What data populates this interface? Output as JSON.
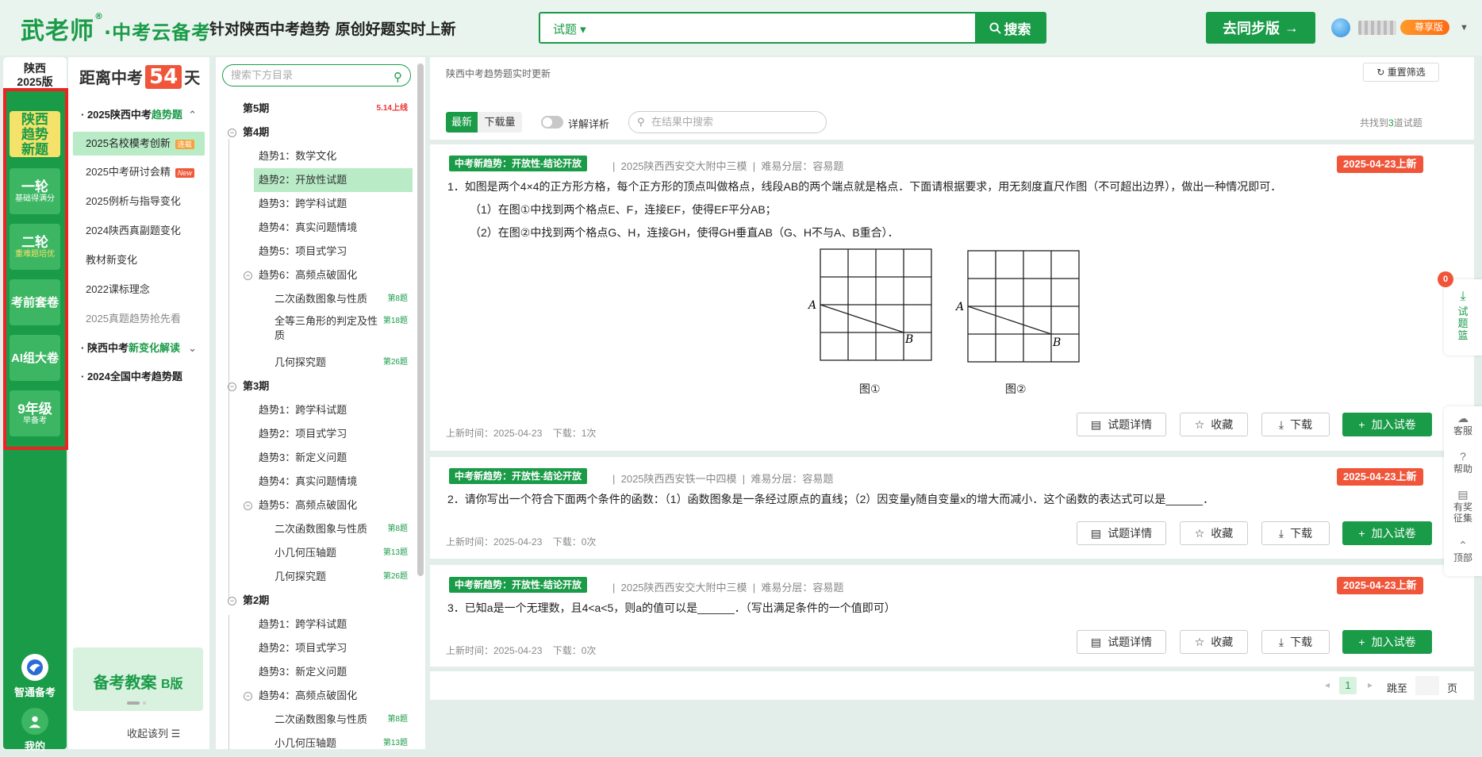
{
  "header": {
    "logo_main": "武老师",
    "logo_reg": "®",
    "logo_sub": "中考云备考",
    "slogan": "针对陕西中考趋势 原创好题实时上新",
    "search_type": "试题",
    "search_button": "搜索",
    "sync_button": "去同步版",
    "vip_label": "尊享版"
  },
  "rail": {
    "region": "陕西",
    "version": "2025版",
    "items": [
      {
        "title": "陕西趋势新题",
        "sub": ""
      },
      {
        "title": "一轮",
        "sub": "基础得满分"
      },
      {
        "title": "二轮",
        "sub": "重难题培优"
      },
      {
        "title": "考前套卷",
        "sub": ""
      },
      {
        "title": "AI组大卷",
        "sub": ""
      },
      {
        "title": "9年级",
        "sub": "早备考"
      }
    ],
    "bottom": [
      {
        "label": "智通备考"
      },
      {
        "label": "我的"
      }
    ]
  },
  "nav": {
    "countdown_prefix": "距离中考",
    "countdown_days": "54",
    "countdown_suffix": "天",
    "section1_title": "2025陕西中考",
    "section1_highlight": "趋势题",
    "items": [
      {
        "label": "2025名校模考创新",
        "tag": "连载"
      },
      {
        "label": "2025中考研讨会精",
        "tag": "New"
      },
      {
        "label": "2025例析与指导变化",
        "tag": ""
      },
      {
        "label": "2024陕西真副题变化",
        "tag": ""
      },
      {
        "label": "教材新变化",
        "tag": ""
      },
      {
        "label": "2022课标理念",
        "tag": ""
      },
      {
        "label": "2025真题趋势抢先看",
        "tag": ""
      }
    ],
    "section2_title": "陕西中考",
    "section2_highlight": "新变化解读",
    "section3_title": "2024全国中考趋势题",
    "promo_title": "备考教案",
    "promo_badge": "B版",
    "collapse_label": "收起该列"
  },
  "tree": {
    "search_placeholder": "搜索下方目录",
    "rows": [
      {
        "label": "第5期",
        "level": 0,
        "count": "5.14上线",
        "red": true
      },
      {
        "label": "第4期",
        "level": 0,
        "count": "",
        "minus": true
      },
      {
        "label": "趋势1：数学文化",
        "level": 1,
        "count": ""
      },
      {
        "label": "趋势2：开放性试题",
        "level": 1,
        "count": "",
        "sel": true
      },
      {
        "label": "趋势3：跨学科试题",
        "level": 1,
        "count": ""
      },
      {
        "label": "趋势4：真实问题情境",
        "level": 1,
        "count": ""
      },
      {
        "label": "趋势5：项目式学习",
        "level": 1,
        "count": ""
      },
      {
        "label": "趋势6：高频点破固化",
        "level": 1,
        "count": "",
        "minus": true
      },
      {
        "label": "二次函数图象与性质",
        "level": 2,
        "count": "第8题"
      },
      {
        "label": "全等三角形的判定及性",
        "level": 2,
        "count": "第18题",
        "line2": "质"
      },
      {
        "label": "几何探究题",
        "level": 2,
        "count": "第26题"
      },
      {
        "label": "第3期",
        "level": 0,
        "count": "",
        "minus": true
      },
      {
        "label": "趋势1：跨学科试题",
        "level": 1,
        "count": ""
      },
      {
        "label": "趋势2：项目式学习",
        "level": 1,
        "count": ""
      },
      {
        "label": "趋势3：新定义问题",
        "level": 1,
        "count": ""
      },
      {
        "label": "趋势4：真实问题情境",
        "level": 1,
        "count": ""
      },
      {
        "label": "趋势5：高频点破固化",
        "level": 1,
        "count": "",
        "minus": true
      },
      {
        "label": "二次函数图象与性质",
        "level": 2,
        "count": "第8题"
      },
      {
        "label": "小几何压轴题",
        "level": 2,
        "count": "第13题"
      },
      {
        "label": "几何探究题",
        "level": 2,
        "count": "第26题"
      },
      {
        "label": "第2期",
        "level": 0,
        "count": "",
        "minus": true
      },
      {
        "label": "趋势1：跨学科试题",
        "level": 1,
        "count": ""
      },
      {
        "label": "趋势2：项目式学习",
        "level": 1,
        "count": ""
      },
      {
        "label": "趋势3：新定义问题",
        "level": 1,
        "count": ""
      },
      {
        "label": "趋势4：高频点破固化",
        "level": 1,
        "count": "",
        "minus": true
      },
      {
        "label": "二次函数图象与性质",
        "level": 2,
        "count": "第8题"
      },
      {
        "label": "小几何压轴题",
        "level": 2,
        "count": "第13题"
      }
    ]
  },
  "main": {
    "update_line": "陕西中考趋势题实时更新",
    "reset_label": "重置筛选",
    "tab_new": "最新",
    "tab_download": "下载量",
    "toggle_label": "详解详析",
    "search_placeholder": "在结果中搜索",
    "found_prefix": "共找到",
    "found_count": "3",
    "found_suffix": "道试题",
    "questions": [
      {
        "badge": "中考新趋势：开放性-结论开放",
        "source": "2025陕西西安交大附中三模",
        "difficulty": "难易分层：容易题",
        "date_tag": "2025-04-23上新",
        "text": "1．如图是两个4×4的正方形方格，每个正方形的顶点叫做格点，线段AB的两个端点就是格点．下面请根据要求，用无刻度直尺作图（不可超出边界），做出一种情况即可．",
        "sub1": "（1）在图①中找到两个格点E、F，连接EF，使得EF平分AB；",
        "sub2": "（2）在图②中找到两个格点G、H，连接GH，使得GH垂直AB（G、H不与A、B重合）．",
        "fig1": "图①",
        "fig2": "图②",
        "fig_label_a": "A",
        "fig_label_b": "B",
        "upd_time": "上新时间：2025-04-23",
        "downloads": "下载：1次"
      },
      {
        "badge": "中考新趋势：开放性-结论开放",
        "source": "2025陕西西安铁一中四模",
        "difficulty": "难易分层：容易题",
        "date_tag": "2025-04-23上新",
        "text": "2．请你写出一个符合下面两个条件的函数：（1）函数图象是一条经过原点的直线；（2）因变量y随自变量x的增大而减小．这个函数的表达式可以是______．",
        "upd_time": "上新时间：2025-04-23",
        "downloads": "下载：0次"
      },
      {
        "badge": "中考新趋势：开放性-结论开放",
        "source": "2025陕西西安交大附中三模",
        "difficulty": "难易分层：容易题",
        "date_tag": "2025-04-23上新",
        "text": "3．已知a是一个无理数，且4<a<5，则a的值可以是______．（写出满足条件的一个值即可）",
        "upd_time": "上新时间：2025-04-23",
        "downloads": "下载：0次"
      }
    ],
    "actions": {
      "detail": "试题详情",
      "fav": "收藏",
      "download": "下载",
      "add": "加入试卷"
    },
    "pager": {
      "current": "1",
      "jump_label": "跳至",
      "page_label": "页"
    }
  },
  "side": {
    "basket_count": "0",
    "basket_label": "试题篮",
    "tools": [
      "客服",
      "帮助",
      "有奖征集",
      "顶部"
    ]
  },
  "colors": {
    "brand_green": "#1a9b48",
    "accent_red": "#f0553a",
    "highlight_yellow": "#f5e26a",
    "selection_green": "#b8ebc6"
  }
}
